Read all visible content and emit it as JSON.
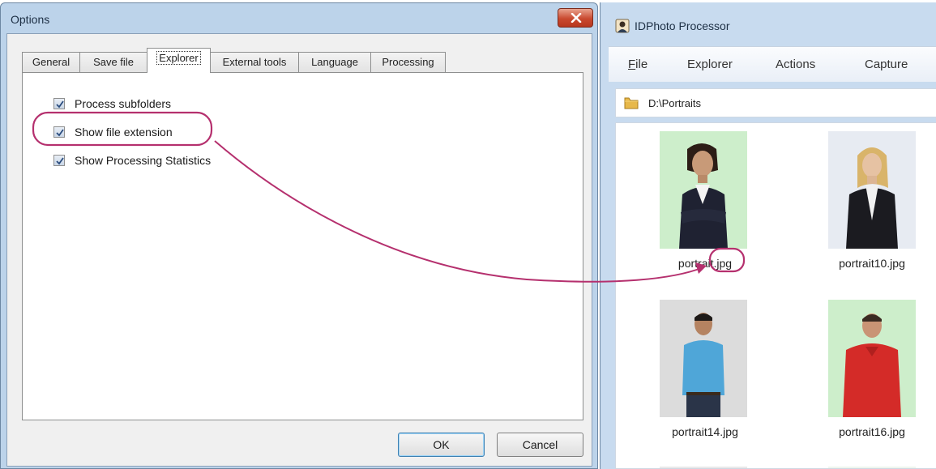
{
  "options_dialog": {
    "title": "Options",
    "tabs": [
      {
        "label": "General"
      },
      {
        "label": "Save file"
      },
      {
        "label": "Explorer"
      },
      {
        "label": "External tools"
      },
      {
        "label": "Language"
      },
      {
        "label": "Processing"
      }
    ],
    "active_tab": "Explorer",
    "checkboxes": [
      {
        "label": "Process subfolders",
        "checked": true
      },
      {
        "label": "Show file extension",
        "checked": true
      },
      {
        "label": "Show Processing Statistics",
        "checked": true
      }
    ],
    "ok_label": "OK",
    "cancel_label": "Cancel"
  },
  "app_window": {
    "title": "IDPhoto Processor",
    "menu": [
      {
        "label": "File",
        "mnemonic": "F",
        "rest": "ile"
      },
      {
        "label": "Explorer"
      },
      {
        "label": "Actions"
      },
      {
        "label": "Capture"
      }
    ],
    "path": "D:\\Portraits",
    "thumbnails": [
      {
        "caption_prefix": "portrait",
        "caption_ext": ".jpg",
        "caption": "portrait.jpg",
        "background": "#cdeecb"
      },
      {
        "caption": "portrait10.jpg",
        "background": "#e7ebf2"
      },
      {
        "caption": "portrait14.jpg",
        "background": "#dcdcdc"
      },
      {
        "caption": "portrait16.jpg",
        "background": "#cdeecb"
      }
    ]
  },
  "annotation": {
    "highlight_color": "#b5306e"
  }
}
